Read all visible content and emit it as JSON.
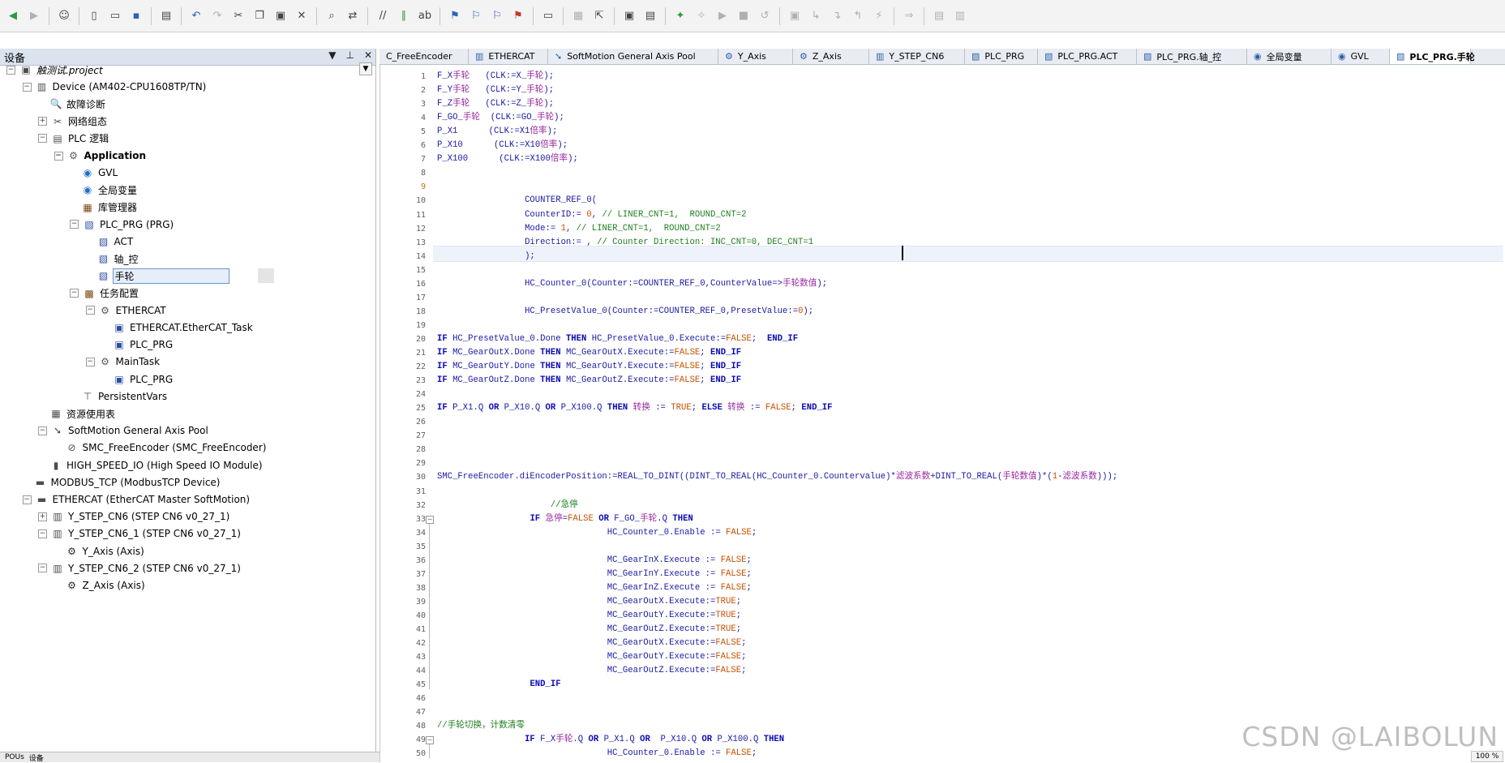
{
  "panel": {
    "title": "设备",
    "pin_glyph": "▼  ⊥",
    "close_glyph": "✕",
    "bottom_tabs": [
      "POUs",
      "设备"
    ]
  },
  "tree": [
    {
      "label": "触测试.project",
      "indent": 0,
      "icon": "project-icon",
      "glyph": "▣",
      "exp": "-",
      "italic": true
    },
    {
      "label": "Device (AM402-CPU1608TP/TN)",
      "indent": 1,
      "icon": "device-icon",
      "glyph": "▥",
      "exp": "-"
    },
    {
      "label": "故障诊断",
      "indent": 2,
      "icon": "diagnosis-icon",
      "glyph": "🔍",
      "exp": ""
    },
    {
      "label": "网络组态",
      "indent": 2,
      "icon": "network-icon",
      "glyph": "✂",
      "exp": "+"
    },
    {
      "label": "PLC 逻辑",
      "indent": 2,
      "icon": "plc-logic-icon",
      "glyph": "▤",
      "exp": "-"
    },
    {
      "label": "Application",
      "indent": 3,
      "icon": "gear-icon",
      "glyph": "⚙",
      "exp": "-",
      "bold": true
    },
    {
      "label": "GVL",
      "indent": 4,
      "icon": "globe-icon",
      "glyph": "◉",
      "exp": ""
    },
    {
      "label": "全局变量",
      "indent": 4,
      "icon": "globe-icon",
      "glyph": "◉",
      "exp": ""
    },
    {
      "label": "库管理器",
      "indent": 4,
      "icon": "library-icon",
      "glyph": "▦",
      "exp": ""
    },
    {
      "label": "PLC_PRG (PRG)",
      "indent": 4,
      "icon": "pou-icon",
      "glyph": "▧",
      "exp": "-"
    },
    {
      "label": "ACT",
      "indent": 5,
      "icon": "action-icon",
      "glyph": "▧",
      "exp": ""
    },
    {
      "label": "轴_控",
      "indent": 5,
      "icon": "action-icon",
      "glyph": "▧",
      "exp": ""
    },
    {
      "label": "手轮",
      "indent": 5,
      "icon": "action-icon",
      "glyph": "▧",
      "exp": "",
      "selected": true
    },
    {
      "label": "任务配置",
      "indent": 4,
      "icon": "task-config-icon",
      "glyph": "▩",
      "exp": "-"
    },
    {
      "label": "ETHERCAT",
      "indent": 5,
      "icon": "task-icon",
      "glyph": "⚙",
      "exp": "-"
    },
    {
      "label": "ETHERCAT.EtherCAT_Task",
      "indent": 6,
      "icon": "call-icon",
      "glyph": "▣",
      "exp": ""
    },
    {
      "label": "PLC_PRG",
      "indent": 6,
      "icon": "call-icon",
      "glyph": "▣",
      "exp": ""
    },
    {
      "label": "MainTask",
      "indent": 5,
      "icon": "task-icon",
      "glyph": "⚙",
      "exp": "-"
    },
    {
      "label": "PLC_PRG",
      "indent": 6,
      "icon": "call-icon",
      "glyph": "▣",
      "exp": ""
    },
    {
      "label": "PersistentVars",
      "indent": 4,
      "icon": "persistent-icon",
      "glyph": "⊤",
      "exp": ""
    },
    {
      "label": "资源使用表",
      "indent": 2,
      "icon": "table-icon",
      "glyph": "▦",
      "exp": ""
    },
    {
      "label": "SoftMotion General Axis Pool",
      "indent": 2,
      "icon": "axis-pool-icon",
      "glyph": "➘",
      "exp": "-"
    },
    {
      "label": "SMC_FreeEncoder (SMC_FreeEncoder)",
      "indent": 3,
      "icon": "encoder-icon",
      "glyph": "⊘",
      "exp": ""
    },
    {
      "label": "HIGH_SPEED_IO (High Speed IO Module)",
      "indent": 2,
      "icon": "module-icon",
      "glyph": "▮",
      "exp": ""
    },
    {
      "label": "MODBUS_TCP (ModbusTCP Device)",
      "indent": 1,
      "icon": "modbus-icon",
      "glyph": "▬",
      "exp": ""
    },
    {
      "label": "ETHERCAT (EtherCAT Master SoftMotion)",
      "indent": 1,
      "icon": "ethercat-icon",
      "glyph": "▬",
      "exp": "-"
    },
    {
      "label": "Y_STEP_CN6 (STEP CN6 v0_27_1)",
      "indent": 2,
      "icon": "drive-icon",
      "glyph": "▥",
      "exp": "+"
    },
    {
      "label": "Y_STEP_CN6_1 (STEP CN6 v0_27_1)",
      "indent": 2,
      "icon": "drive-icon",
      "glyph": "▥",
      "exp": "-"
    },
    {
      "label": "Y_Axis (Axis)",
      "indent": 3,
      "icon": "axis-icon",
      "glyph": "⚙",
      "exp": ""
    },
    {
      "label": "Y_STEP_CN6_2 (STEP CN6 v0_27_1)",
      "indent": 2,
      "icon": "drive-icon",
      "glyph": "▥",
      "exp": "-"
    },
    {
      "label": "Z_Axis (Axis)",
      "indent": 3,
      "icon": "axis-icon",
      "glyph": "⚙",
      "exp": ""
    }
  ],
  "tabs": [
    {
      "label": "C_FreeEncoder",
      "icon": ""
    },
    {
      "label": "ETHERCAT",
      "icon": "▥"
    },
    {
      "label": "SoftMotion General Axis Pool",
      "icon": "➘"
    },
    {
      "label": "Y_Axis",
      "icon": "⚙"
    },
    {
      "label": "Z_Axis",
      "icon": "⚙"
    },
    {
      "label": "Y_STEP_CN6",
      "icon": "▥"
    },
    {
      "label": "PLC_PRG",
      "icon": "▧"
    },
    {
      "label": "PLC_PRG.ACT",
      "icon": "▧"
    },
    {
      "label": "PLC_PRG.轴_控",
      "icon": "▧"
    },
    {
      "label": "全局变量",
      "icon": "◉"
    },
    {
      "label": "GVL",
      "icon": "◉"
    },
    {
      "label": "PLC_PRG.手轮",
      "icon": "▧",
      "active": true
    }
  ],
  "code": [
    {
      "n": 1,
      "t": "F_X手轮   (CLK:=X_手轮);"
    },
    {
      "n": 2,
      "t": "F_Y手轮   (CLK:=Y_手轮);"
    },
    {
      "n": 3,
      "t": "F_Z手轮   (CLK:=Z_手轮);"
    },
    {
      "n": 4,
      "t": "F_GO_手轮  (CLK:=GO_手轮);"
    },
    {
      "n": 5,
      "t": "P_X1      (CLK:=X1倍率);"
    },
    {
      "n": 6,
      "t": "P_X10      (CLK:=X10倍率);"
    },
    {
      "n": 7,
      "t": "P_X100      (CLK:=X100倍率);"
    },
    {
      "n": 8,
      "t": ""
    },
    {
      "n": 9,
      "t": ""
    },
    {
      "n": 10,
      "t": "                 COUNTER_REF_0("
    },
    {
      "n": 11,
      "t": "                 CounterID:= 0, // LINER_CNT=1,  ROUND_CNT=2"
    },
    {
      "n": 12,
      "t": "                 Mode:= 1, // LINER_CNT=1,  ROUND_CNT=2"
    },
    {
      "n": 13,
      "t": "                 Direction:= , // Counter Direction: INC_CNT=0, DEC_CNT=1"
    },
    {
      "n": 14,
      "t": "                 );"
    },
    {
      "n": 15,
      "t": ""
    },
    {
      "n": 16,
      "t": "                 HC_Counter_0(Counter:=COUNTER_REF_0,CounterValue=>手轮数值);"
    },
    {
      "n": 17,
      "t": ""
    },
    {
      "n": 18,
      "t": "                 HC_PresetValue_0(Counter:=COUNTER_REF_0,PresetValue:=0);"
    },
    {
      "n": 19,
      "t": ""
    },
    {
      "n": 20,
      "t": "IF HC_PresetValue_0.Done THEN HC_PresetValue_0.Execute:=FALSE;  END_IF"
    },
    {
      "n": 21,
      "t": "IF MC_GearOutX.Done THEN MC_GearOutX.Execute:=FALSE; END_IF"
    },
    {
      "n": 22,
      "t": "IF MC_GearOutY.Done THEN MC_GearOutY.Execute:=FALSE; END_IF"
    },
    {
      "n": 23,
      "t": "IF MC_GearOutZ.Done THEN MC_GearOutZ.Execute:=FALSE; END_IF"
    },
    {
      "n": 24,
      "t": ""
    },
    {
      "n": 25,
      "t": "IF P_X1.Q OR P_X10.Q OR P_X100.Q THEN 转换 := TRUE; ELSE 转换 := FALSE; END_IF"
    },
    {
      "n": 26,
      "t": ""
    },
    {
      "n": 27,
      "t": ""
    },
    {
      "n": 28,
      "t": ""
    },
    {
      "n": 29,
      "t": ""
    },
    {
      "n": 30,
      "t": "SMC_FreeEncoder.diEncoderPosition:=REAL_TO_DINT((DINT_TO_REAL(HC_Counter_0.Countervalue)*滤波系数+DINT_TO_REAL(手轮数值)*(1-滤波系数)));"
    },
    {
      "n": 31,
      "t": ""
    },
    {
      "n": 32,
      "t": "                      //急停"
    },
    {
      "n": 33,
      "t": "                  IF 急停=FALSE OR F_GO_手轮.Q THEN"
    },
    {
      "n": 34,
      "t": "                                 HC_Counter_0.Enable := FALSE;"
    },
    {
      "n": 35,
      "t": ""
    },
    {
      "n": 36,
      "t": "                                 MC_GearInX.Execute := FALSE;"
    },
    {
      "n": 37,
      "t": "                                 MC_GearInY.Execute := FALSE;"
    },
    {
      "n": 38,
      "t": "                                 MC_GearInZ.Execute := FALSE;"
    },
    {
      "n": 39,
      "t": "                                 MC_GearOutX.Execute:=TRUE;"
    },
    {
      "n": 40,
      "t": "                                 MC_GearOutY.Execute:=TRUE;"
    },
    {
      "n": 41,
      "t": "                                 MC_GearOutZ.Execute:=TRUE;"
    },
    {
      "n": 42,
      "t": "                                 MC_GearOutX.Execute:=FALSE;"
    },
    {
      "n": 43,
      "t": "                                 MC_GearOutY.Execute:=FALSE;"
    },
    {
      "n": 44,
      "t": "                                 MC_GearOutZ.Execute:=FALSE;"
    },
    {
      "n": 45,
      "t": "                  END_IF"
    },
    {
      "n": 46,
      "t": ""
    },
    {
      "n": 47,
      "t": ""
    },
    {
      "n": 48,
      "t": "//手轮切换，计数清零"
    },
    {
      "n": 49,
      "t": "                 IF F_X手轮.Q OR P_X1.Q OR  P_X10.Q OR P_X100.Q THEN"
    },
    {
      "n": 50,
      "t": "                                 HC_Counter_0.Enable := FALSE;"
    }
  ],
  "fold_lines": [
    33,
    49
  ],
  "cursor_line": 9,
  "zoom": "100 %",
  "watermark": "CSDN @LAIBOLUN",
  "colors": {
    "keyword": "#0a0ab5",
    "comment": "#208020",
    "number": "#c85000",
    "identifier": "#1a1aa6",
    "chinese_identifier": "#9a2aa0"
  }
}
